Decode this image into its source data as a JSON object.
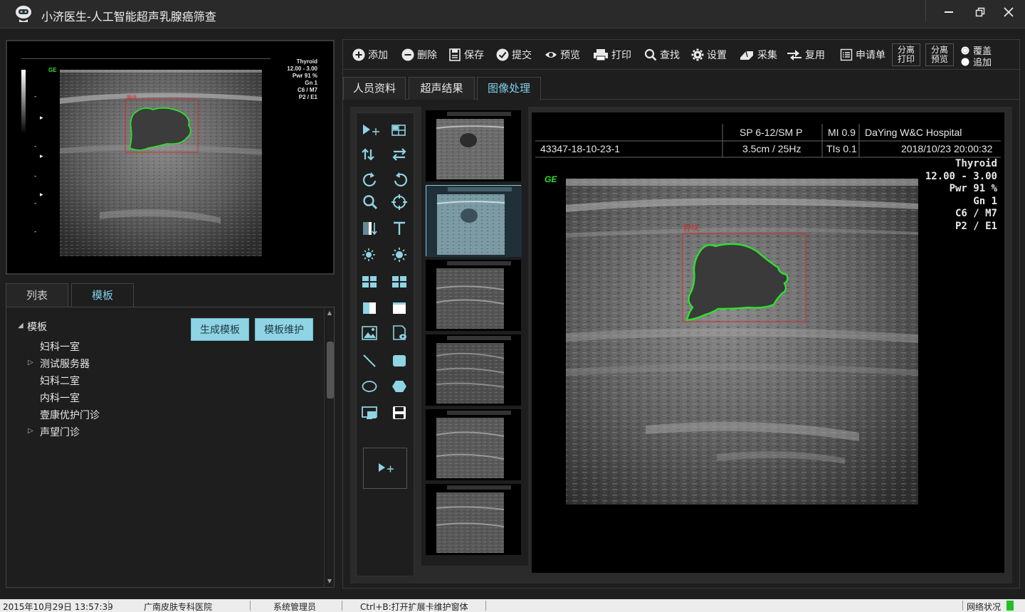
{
  "app": {
    "title": "小济医生-人工智能超声乳腺癌筛查",
    "window_controls": [
      "minimize",
      "restore",
      "close"
    ]
  },
  "left": {
    "preview_overlay": [
      "Thyroid",
      "12.00 - 3.00",
      "Pwr  91 %",
      "Gn   1",
      "C6 / M7",
      "P2 / E1"
    ],
    "preview_badge": "GE",
    "tabs": [
      {
        "label": "列表",
        "active": false
      },
      {
        "label": "模板",
        "active": true
      }
    ],
    "buttons": {
      "generate": "生成模板",
      "maintain": "模板维护"
    },
    "tree": {
      "root": "模板",
      "items": [
        {
          "label": "妇科一室",
          "expandable": false
        },
        {
          "label": "测试服务器",
          "expandable": true
        },
        {
          "label": "妇科二室",
          "expandable": false
        },
        {
          "label": "内科一室",
          "expandable": false
        },
        {
          "label": "壹康优护门诊",
          "expandable": false
        },
        {
          "label": "声望门诊",
          "expandable": true
        }
      ]
    }
  },
  "toolbar": {
    "items": [
      {
        "label": "添加",
        "icon": "plus-circle-icon"
      },
      {
        "label": "删除",
        "icon": "minus-circle-icon"
      },
      {
        "label": "保存",
        "icon": "save-doc-icon"
      },
      {
        "label": "提交",
        "icon": "check-circle-icon"
      },
      {
        "label": "预览",
        "icon": "eye-icon"
      },
      {
        "label": "打印",
        "icon": "printer-icon"
      },
      {
        "label": "查找",
        "icon": "search-icon"
      },
      {
        "label": "设置",
        "icon": "gear-icon"
      },
      {
        "label": "采集",
        "icon": "eraser-icon"
      },
      {
        "label": "复用",
        "icon": "reuse-arrows-icon"
      },
      {
        "label": "申请单",
        "icon": "form-list-icon"
      }
    ],
    "split_print": [
      "分离",
      "打印"
    ],
    "split_preview": [
      "分离",
      "预览"
    ],
    "radios": [
      {
        "label": "覆盖",
        "checked": false
      },
      {
        "label": "追加",
        "checked": true
      }
    ]
  },
  "tabs": [
    {
      "label": "人员资料",
      "active": false
    },
    {
      "label": "超声结果",
      "active": false
    },
    {
      "label": "图像处理",
      "active": true
    }
  ],
  "main_image": {
    "header_row1": {
      "mode": "SP 6-12/SM P",
      "mi": "MI  0.9",
      "hospital": "DaYing W&C Hospital"
    },
    "header_row2": {
      "id": "43347-18-10-23-1",
      "depth": "3.5cm / 25Hz",
      "tis": "TIs  0.1",
      "datetime": "2018/10/23  20:00:32"
    },
    "overlay": [
      "Thyroid",
      "12.00 - 3.00",
      "Pwr  91 %",
      "Gn   1",
      "C6 / M7",
      "P2 / E1"
    ],
    "badge": "GE",
    "roi_label": "肿块"
  },
  "statusbar": {
    "datetime": "2015年10月29日 13:57:39",
    "hospital": "广南皮肤专科医院",
    "user": "系统管理员",
    "hint": "Ctrl+B:打开扩展卡维护窗体",
    "network": "网络状况",
    "network_color": "#22c022"
  }
}
